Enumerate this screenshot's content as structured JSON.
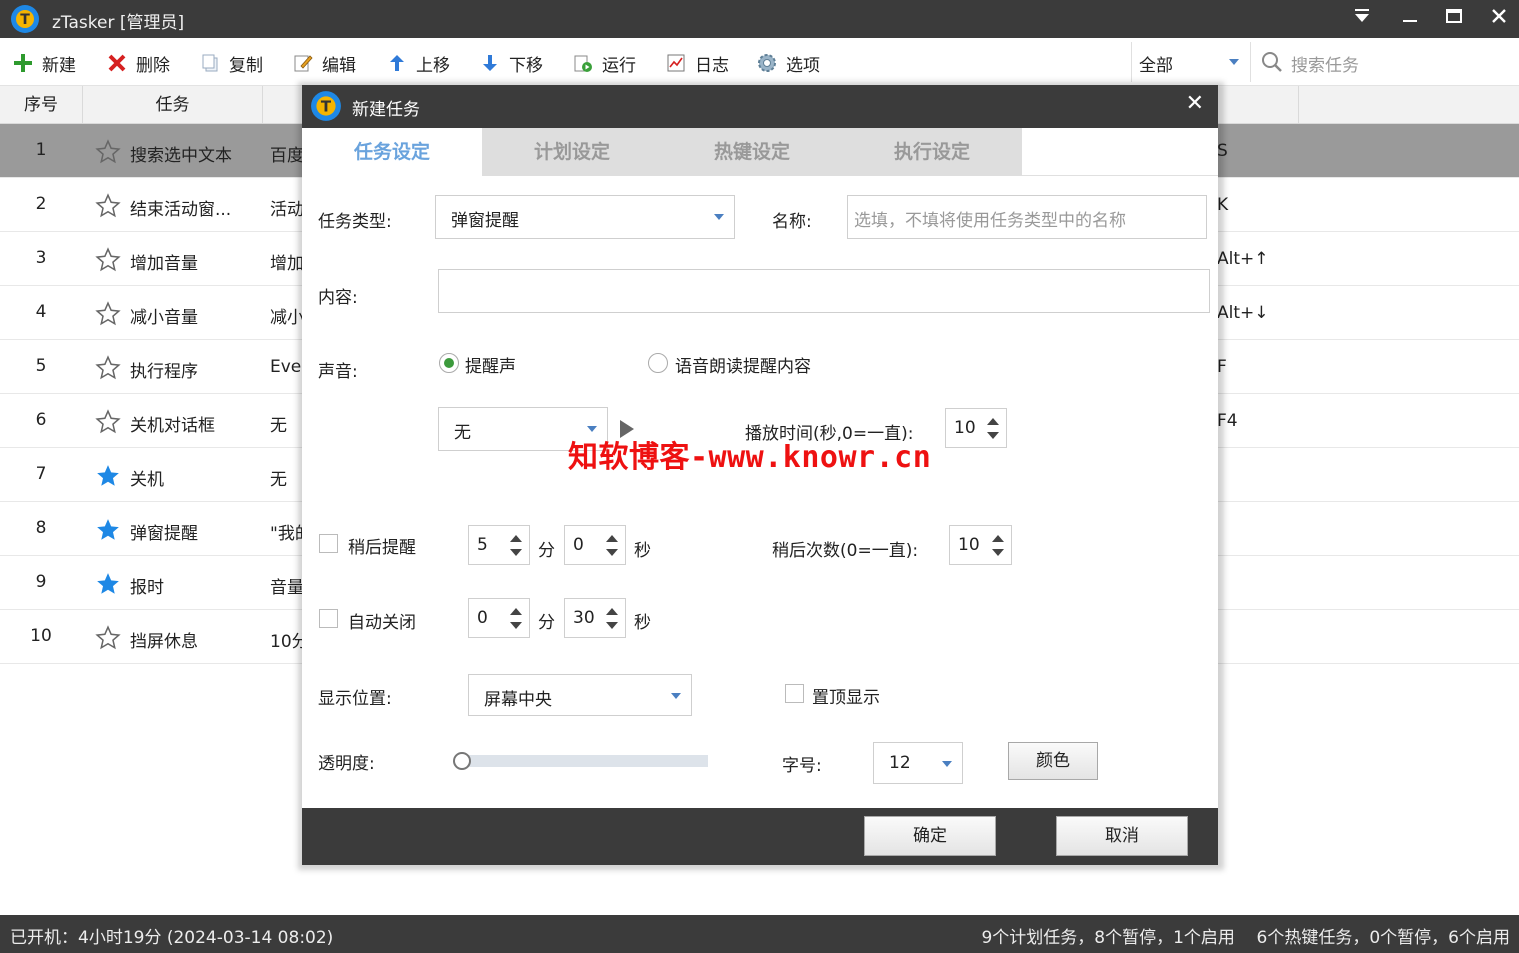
{
  "window": {
    "title": "zTasker [管理员]"
  },
  "toolbar": {
    "new": "新建",
    "delete": "删除",
    "copy": "复制",
    "edit": "编辑",
    "move_up": "上移",
    "move_down": "下移",
    "run": "运行",
    "log": "日志",
    "options": "选项"
  },
  "filter": {
    "selected": "全部"
  },
  "search": {
    "placeholder": "搜索任务"
  },
  "table": {
    "columns": [
      "序号",
      "任务",
      "",
      ""
    ],
    "rows": [
      {
        "num": "1",
        "name": "搜索选中文本",
        "content": "百度",
        "hotkey": "S",
        "starred": false
      },
      {
        "num": "2",
        "name": "结束活动窗...",
        "content": "活动",
        "hotkey": "K",
        "starred": false
      },
      {
        "num": "3",
        "name": "增加音量",
        "content": "增加",
        "hotkey": "Alt+↑",
        "starred": false
      },
      {
        "num": "4",
        "name": "减小音量",
        "content": "减小",
        "hotkey": "Alt+↓",
        "starred": false
      },
      {
        "num": "5",
        "name": "执行程序",
        "content": "Ever",
        "hotkey": "F",
        "starred": false
      },
      {
        "num": "6",
        "name": "关机对话框",
        "content": "无",
        "hotkey": "F4",
        "starred": false
      },
      {
        "num": "7",
        "name": "关机",
        "content": "无",
        "hotkey": "",
        "starred": true
      },
      {
        "num": "8",
        "name": "弹窗提醒",
        "content": "\"我的",
        "hotkey": "",
        "starred": true
      },
      {
        "num": "9",
        "name": "报时",
        "content": "音量",
        "hotkey": "",
        "starred": true
      },
      {
        "num": "10",
        "name": "挡屏休息",
        "content": "10分",
        "hotkey": "",
        "starred": false
      }
    ]
  },
  "dialog": {
    "title": "新建任务",
    "close": "✕",
    "tabs": [
      "任务设定",
      "计划设定",
      "热键设定",
      "执行设定"
    ],
    "task_type_label": "任务类型:",
    "task_type_value": "弹窗提醒",
    "name_label": "名称:",
    "name_placeholder": "选填，不填将使用任务类型中的名称",
    "content_label": "内容:",
    "sound_label": "声音:",
    "radio_alert": "提醒声",
    "radio_tts": "语音朗读提醒内容",
    "sound_value": "无",
    "play_time_label": "播放时间(秒,0=一直):",
    "play_time_value": "10",
    "snooze_label": "稍后提醒",
    "snooze_min": "5",
    "min_unit": "分",
    "snooze_sec": "0",
    "sec_unit": "秒",
    "snooze_count_label": "稍后次数(0=一直):",
    "snooze_count_value": "10",
    "autoclose_label": "自动关闭",
    "autoclose_min": "0",
    "autoclose_sec": "30",
    "position_label": "显示位置:",
    "position_value": "屏幕中央",
    "topmost_label": "置顶显示",
    "opacity_label": "透明度:",
    "opacity_value": 0,
    "fontsize_label": "字号:",
    "fontsize_value": "12",
    "color_button": "颜色",
    "ok": "确定",
    "cancel": "取消"
  },
  "watermark": "知软博客-www.knowr.cn",
  "status": {
    "uptime": "已开机：4小时19分 (2024-03-14 08:02)",
    "summary": "9个计划任务，8个暂停，1个启用    6个热键任务，0个暂停，6个启用"
  },
  "colors": {
    "titlebar": "#3b3b3b",
    "accent_tab": "#6aa3dd",
    "star_filled": "#1e88e5",
    "watermark": "#ee1111"
  }
}
